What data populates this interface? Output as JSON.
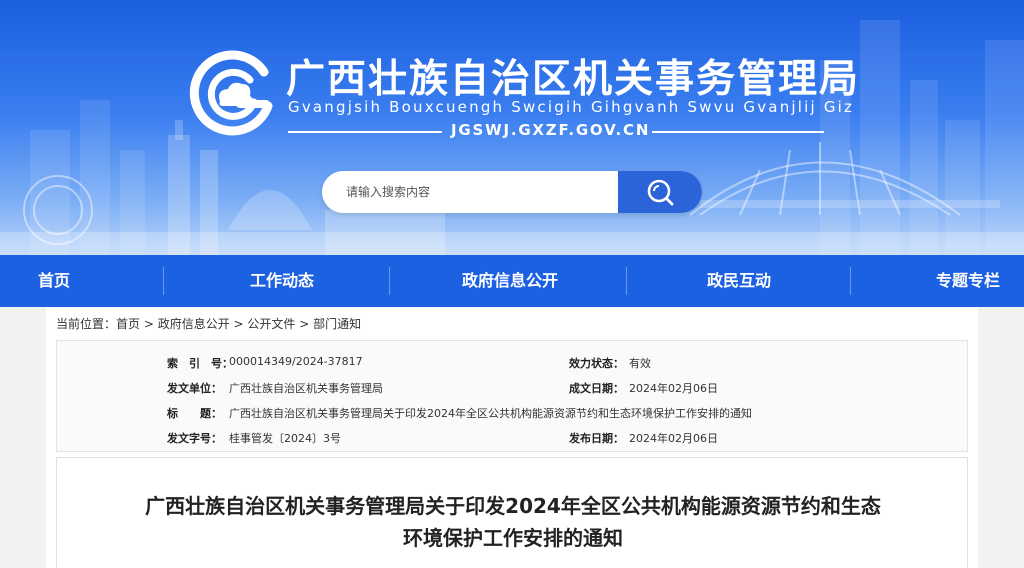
{
  "header": {
    "title": "广西壮族自治区机关事务管理局",
    "subtitle": "Gvangjsih Bouxcuengh Swcigih Gihgvanh Swvu Gvanjlij Giz",
    "domain": "JGSWJ.GXZF.GOV.CN",
    "logo_icon": "cloud-g-logo-icon"
  },
  "search": {
    "placeholder": "请输入搜索内容",
    "button_icon": "search-icon"
  },
  "nav": {
    "items": [
      {
        "label": "首页"
      },
      {
        "label": "工作动态"
      },
      {
        "label": "政府信息公开"
      },
      {
        "label": "政民互动"
      },
      {
        "label": "专题专栏"
      }
    ]
  },
  "breadcrumb": {
    "prefix": "当前位置：",
    "items": [
      "首页",
      "政府信息公开",
      "公开文件",
      "部门通知"
    ],
    "separator": " > "
  },
  "meta": {
    "index_label": "索　引　号：",
    "index_value": "000014349/2024-37817",
    "status_label": "效力状态：",
    "status_value": "有效",
    "issuer_label": "发文单位：",
    "issuer_value": "广西壮族自治区机关事务管理局",
    "created_label": "成文日期：",
    "created_value": "2024年02月06日",
    "title_label": "标　　题：",
    "title_value": "广西壮族自治区机关事务管理局关于印发2024年全区公共机构能源资源节约和生态环境保护工作安排的通知",
    "docno_label": "发文字号：",
    "docno_value": "桂事管发〔2024〕3号",
    "published_label": "发布日期：",
    "published_value": "2024年02月06日"
  },
  "document": {
    "title_line1": "广西壮族自治区机关事务管理局关于印发2024年全区公共机构能源资源节约和生态",
    "title_line2": "环境保护工作安排的通知"
  },
  "colors": {
    "nav_bg": "#1d61e3",
    "search_button": "#2a64d8",
    "banner_top": "#1c5fe0"
  }
}
